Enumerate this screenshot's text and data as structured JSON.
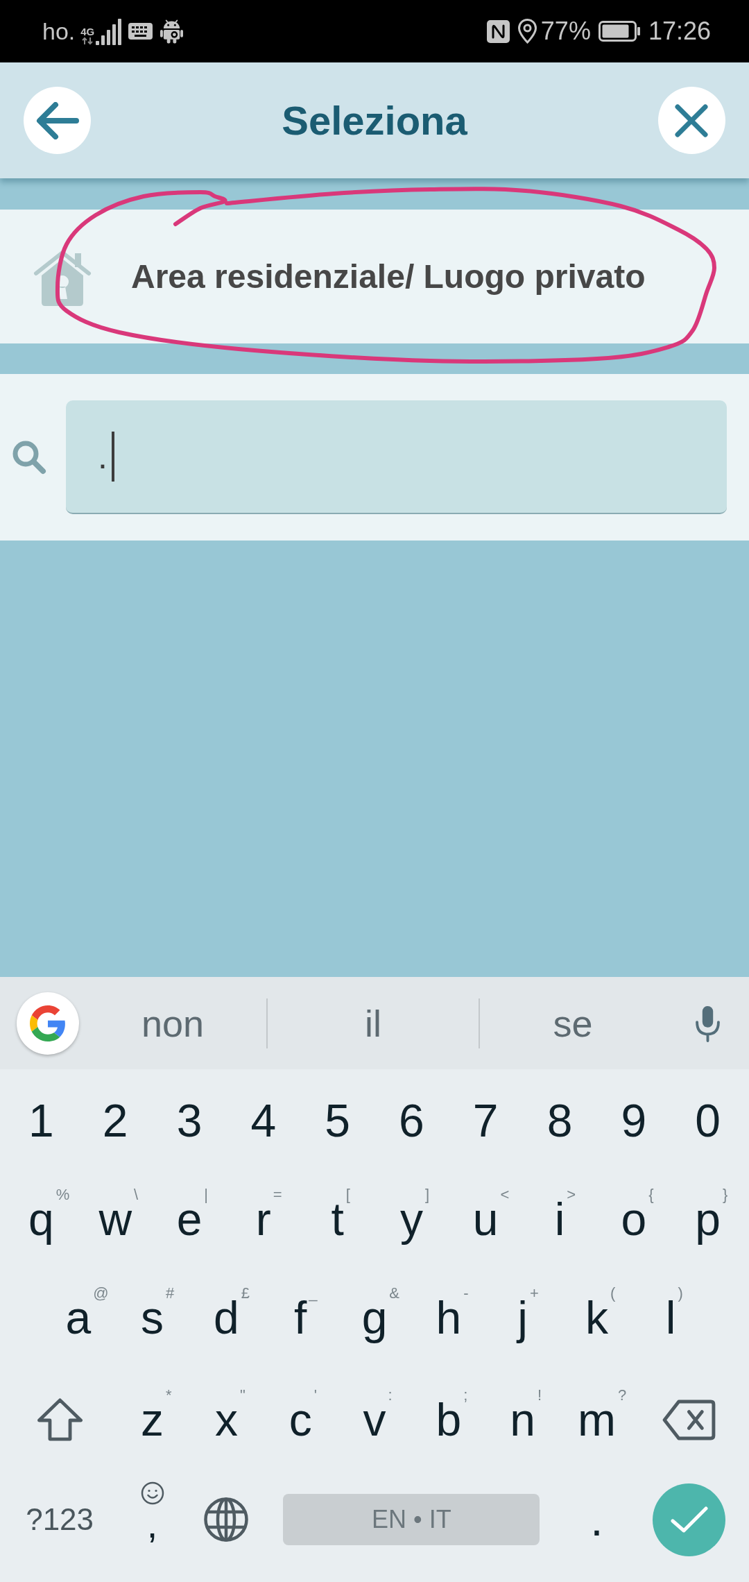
{
  "status_bar": {
    "carrier": "ho.",
    "network": "4G",
    "battery": "77%",
    "time": "17:26"
  },
  "header": {
    "title": "Seleziona"
  },
  "options": [
    {
      "label": "Area residenziale/ Luogo privato"
    }
  ],
  "search": {
    "value": "."
  },
  "keyboard": {
    "suggestions": [
      "non",
      "il",
      "se"
    ],
    "rows": [
      [
        {
          "kind": "char",
          "label": "1"
        },
        {
          "kind": "char",
          "label": "2"
        },
        {
          "kind": "char",
          "label": "3"
        },
        {
          "kind": "char",
          "label": "4"
        },
        {
          "kind": "char",
          "label": "5"
        },
        {
          "kind": "char",
          "label": "6"
        },
        {
          "kind": "char",
          "label": "7"
        },
        {
          "kind": "char",
          "label": "8"
        },
        {
          "kind": "char",
          "label": "9"
        },
        {
          "kind": "char",
          "label": "0"
        }
      ],
      [
        {
          "kind": "char",
          "label": "q",
          "hint": "%"
        },
        {
          "kind": "char",
          "label": "w",
          "hint": "\\"
        },
        {
          "kind": "char",
          "label": "e",
          "hint": "|"
        },
        {
          "kind": "char",
          "label": "r",
          "hint": "="
        },
        {
          "kind": "char",
          "label": "t",
          "hint": "["
        },
        {
          "kind": "char",
          "label": "y",
          "hint": "]"
        },
        {
          "kind": "char",
          "label": "u",
          "hint": "<"
        },
        {
          "kind": "char",
          "label": "i",
          "hint": ">"
        },
        {
          "kind": "char",
          "label": "o",
          "hint": "{"
        },
        {
          "kind": "char",
          "label": "p",
          "hint": "}"
        }
      ],
      [
        {
          "kind": "char",
          "label": "a",
          "hint": "@"
        },
        {
          "kind": "char",
          "label": "s",
          "hint": "#"
        },
        {
          "kind": "char",
          "label": "d",
          "hint": "£"
        },
        {
          "kind": "char",
          "label": "f",
          "hint": "_"
        },
        {
          "kind": "char",
          "label": "g",
          "hint": "&"
        },
        {
          "kind": "char",
          "label": "h",
          "hint": "-"
        },
        {
          "kind": "char",
          "label": "j",
          "hint": "+"
        },
        {
          "kind": "char",
          "label": "k",
          "hint": "("
        },
        {
          "kind": "char",
          "label": "l",
          "hint": ")"
        }
      ],
      [
        {
          "kind": "shift"
        },
        {
          "kind": "char",
          "label": "z",
          "hint": "*"
        },
        {
          "kind": "char",
          "label": "x",
          "hint": "\""
        },
        {
          "kind": "char",
          "label": "c",
          "hint": "'"
        },
        {
          "kind": "char",
          "label": "v",
          "hint": ":"
        },
        {
          "kind": "char",
          "label": "b",
          "hint": ";"
        },
        {
          "kind": "char",
          "label": "n",
          "hint": "!"
        },
        {
          "kind": "char",
          "label": "m",
          "hint": "?"
        },
        {
          "kind": "backspace"
        }
      ],
      [
        {
          "kind": "symbols",
          "label": "?123"
        },
        {
          "kind": "comma",
          "label": ","
        },
        {
          "kind": "globe"
        },
        {
          "kind": "space",
          "label": "EN • IT"
        },
        {
          "kind": "char",
          "label": "."
        },
        {
          "kind": "enter"
        }
      ]
    ]
  }
}
